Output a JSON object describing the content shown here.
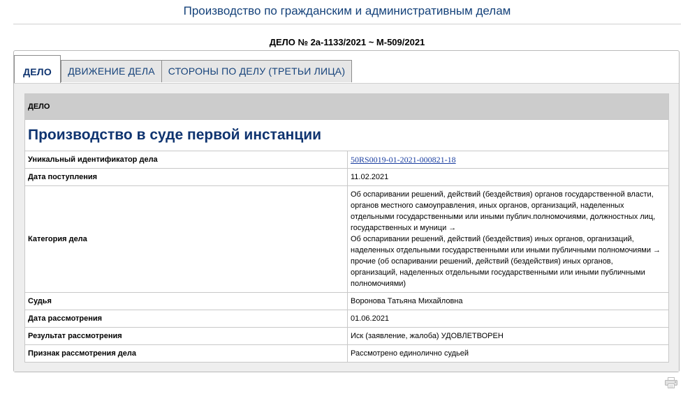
{
  "page": {
    "title": "Производство по гражданским и административным делам",
    "case_number": "ДЕЛО № 2а-1133/2021 ~ М-509/2021"
  },
  "tabs": [
    {
      "label": "ДЕЛО",
      "active": true
    },
    {
      "label": "ДВИЖЕНИЕ ДЕЛА",
      "active": false
    },
    {
      "label": "СТОРОНЫ ПО ДЕЛУ (ТРЕТЬИ ЛИЦА)",
      "active": false
    }
  ],
  "case": {
    "section_header": "ДЕЛО",
    "instance_title": "Производство в суде первой инстанции",
    "rows": {
      "uid": {
        "label": "Уникальный идентификатор дела",
        "value": "50RS0019-01-2021-000821-18"
      },
      "received": {
        "label": "Дата поступления",
        "value": "11.02.2021"
      },
      "category": {
        "label": "Категория дела",
        "line1": "Об оспаривании решений, действий (бездействия) органов государственной власти,",
        "line2": "органов местного самоуправления, иных органов, организаций, наделенных",
        "line3": "отдельными государственными или иными публич.полномочиями, должностных лиц,",
        "line4": "государственных и муници →",
        "line5": "Об оспаривании решений, действий (бездействия) иных органов, организаций,",
        "line6": "наделенных отдельными государственными или иными публичными полномочиями →",
        "line7": "прочие (об оспаривании решений, действий (бездействия) иных органов,",
        "line8": "организаций, наделенных отдельными государственными или иными публичными",
        "line9": "полномочиями)"
      },
      "judge": {
        "label": "Судья",
        "value": "Воронова Татьяна Михайловна"
      },
      "review_date": {
        "label": "Дата рассмотрения",
        "value": "01.06.2021"
      },
      "result": {
        "label": "Результат рассмотрения",
        "value": "Иск (заявление, жалоба) УДОВЛЕТВОРЕН"
      },
      "sign": {
        "label": "Признак рассмотрения дела",
        "value": "Рассмотрено единолично судьей"
      }
    }
  },
  "icons": {
    "print": "printer-icon"
  }
}
